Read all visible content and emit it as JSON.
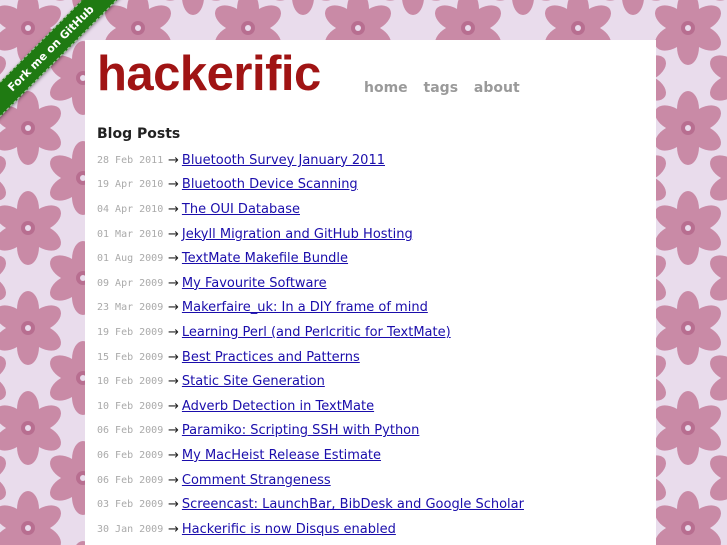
{
  "ribbon": {
    "label": "Fork me on GitHub"
  },
  "site": {
    "title": "hackerific"
  },
  "nav": {
    "items": [
      "home",
      "tags",
      "about"
    ]
  },
  "main": {
    "heading": "Blog Posts",
    "arrow": "→",
    "posts": [
      {
        "date": "28 Feb 2011",
        "title": "Bluetooth Survey January 2011"
      },
      {
        "date": "19 Apr 2010",
        "title": "Bluetooth Device Scanning"
      },
      {
        "date": "04 Apr 2010",
        "title": "The OUI Database"
      },
      {
        "date": "01 Mar 2010",
        "title": "Jekyll Migration and GitHub Hosting"
      },
      {
        "date": "01 Aug 2009",
        "title": "TextMate Makefile Bundle"
      },
      {
        "date": "09 Apr 2009",
        "title": "My Favourite Software"
      },
      {
        "date": "23 Mar 2009",
        "title": "Makerfaire_uk: In a DIY frame of mind"
      },
      {
        "date": "19 Feb 2009",
        "title": "Learning Perl (and Perlcritic for TextMate)"
      },
      {
        "date": "15 Feb 2009",
        "title": "Best Practices and Patterns"
      },
      {
        "date": "10 Feb 2009",
        "title": "Static Site Generation"
      },
      {
        "date": "10 Feb 2009",
        "title": "Adverb Detection in TextMate"
      },
      {
        "date": "06 Feb 2009",
        "title": "Paramiko: Scripting SSH with Python"
      },
      {
        "date": "06 Feb 2009",
        "title": "My MacHeist Release Estimate"
      },
      {
        "date": "06 Feb 2009",
        "title": "Comment Strangeness"
      },
      {
        "date": "03 Feb 2009",
        "title": "Screencast: LaunchBar, BibDesk and Google Scholar"
      },
      {
        "date": "30 Jan 2009",
        "title": "Hackerific is now Disqus enabled"
      }
    ]
  },
  "colors": {
    "background": "#e9dcec",
    "flower": "#c98aa6",
    "flower_center": "#b86e90",
    "title": "#a01414",
    "nav": "#9a9a9a",
    "link": "#1a0dab",
    "date": "#aaaaaa",
    "ribbon": "#1f7a12"
  }
}
